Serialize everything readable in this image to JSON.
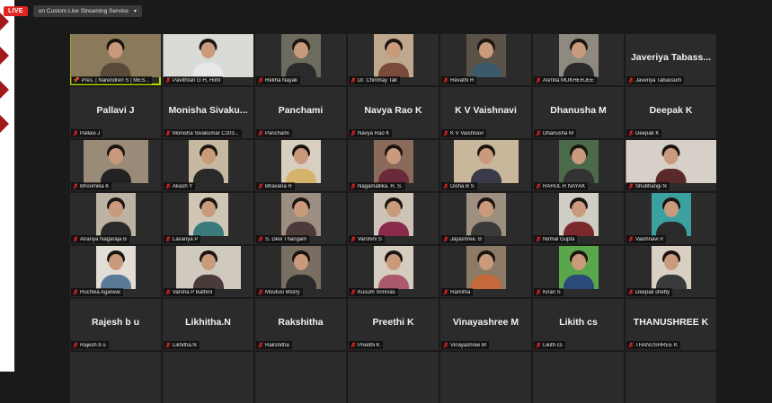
{
  "topbar": {
    "live_badge": "LIVE",
    "stream_dropdown": "on Custom Live Streaming Service"
  },
  "participants": [
    {
      "label": "Pres. | Narendren S | MES...",
      "display": "video",
      "highlight": true,
      "pinned": true,
      "bg": "#8a7a5a",
      "shirt": "#5a4a3a"
    },
    {
      "label": "Pavithran G H, Himt",
      "display": "video",
      "bg": "#d9dcd6",
      "shirt": "#e8e8e8"
    },
    {
      "label": "Rekha Nayak",
      "display": "video",
      "bg": "#6d6a5e",
      "shirt": "#2a2a2a"
    },
    {
      "label": "Dr. Chinmay Tak",
      "display": "video",
      "bg": "#bfa88e",
      "shirt": "#7a4a3a"
    },
    {
      "label": "Revathi R",
      "display": "video",
      "bg": "#5c5348",
      "shirt": "#3a5a6a"
    },
    {
      "label": "Asmita MUKHERJEE",
      "display": "video",
      "bg": "#8e8a80",
      "shirt": "#2a2a2a"
    },
    {
      "label": "Javeriya Tabassum",
      "display": "name",
      "name": "Javeriya Tabass..."
    },
    {
      "label": "Pallavi J",
      "display": "name",
      "name": "Pallavi J"
    },
    {
      "label": "Monisha Sivakumar C203...",
      "display": "name",
      "name": "Monisha Sivaku..."
    },
    {
      "label": "Panchami",
      "display": "name",
      "name": "Panchami"
    },
    {
      "label": "Navya Rao K",
      "display": "name",
      "name": "Navya Rao K"
    },
    {
      "label": "K V Vaishnavi",
      "display": "name",
      "name": "K V Vaishnavi"
    },
    {
      "label": "Dhanusha M",
      "display": "name",
      "name": "Dhanusha M"
    },
    {
      "label": "Deepak K",
      "display": "name",
      "name": "Deepak K"
    },
    {
      "label": "Bhoomika K",
      "display": "video",
      "bg": "#9a8a78",
      "shirt": "#222"
    },
    {
      "label": "Akash Y",
      "display": "video",
      "bg": "#c7b9a1",
      "shirt": "#2a2a2a"
    },
    {
      "label": "Bhavana R",
      "display": "video",
      "bg": "#d8cfc1",
      "shirt": "#d6b36a"
    },
    {
      "label": "Nagamallika. R. S.",
      "display": "video",
      "bg": "#8a6a5a",
      "shirt": "#6a2a3a"
    },
    {
      "label": "Disha B S",
      "display": "video",
      "bg": "#c8b79a",
      "shirt": "#3a3a4a"
    },
    {
      "label": "RAHUL R NAYAK",
      "display": "video",
      "bg": "#4a6a4a",
      "shirt": "#333"
    },
    {
      "label": "Shubhangi N",
      "display": "video",
      "bg": "#d6d0c8",
      "shirt": "#5a2a2a"
    },
    {
      "label": "Ananya Nagaraja B",
      "display": "video",
      "bg": "#bdb3a4",
      "shirt": "#2a2a2a"
    },
    {
      "label": "Lavanya P",
      "display": "video",
      "bg": "#cfc6b5",
      "shirt": "#3a7a7a"
    },
    {
      "label": "S. Devi Thangam",
      "display": "video",
      "bg": "#9c8e80",
      "shirt": "#4a3a3a"
    },
    {
      "label": "Varshini S",
      "display": "video",
      "bg": "#cdc4b7",
      "shirt": "#8a2a4a"
    },
    {
      "label": "Jayashree. B",
      "display": "video",
      "bg": "#9e9080",
      "shirt": "#3a3a3a"
    },
    {
      "label": "Nirmal Gupta",
      "display": "video",
      "bg": "#d0cdc6",
      "shirt": "#7a2a2a"
    },
    {
      "label": "Vaishnavi.V",
      "display": "video",
      "bg": "#3aa0a0",
      "shirt": "#2a2a2a"
    },
    {
      "label": "Ruchika Agarwal",
      "display": "video",
      "bg": "#e2ddd5",
      "shirt": "#5a7a9a"
    },
    {
      "label": "Varsha P Bathini",
      "display": "video",
      "bg": "#cfc9be",
      "shirt": "#4a3a3a"
    },
    {
      "label": "Moutusi Mistry",
      "display": "video",
      "bg": "#7a6e62",
      "shirt": "#2a2a2a"
    },
    {
      "label": "Kusum Srinivas",
      "display": "video",
      "bg": "#d5cdc0",
      "shirt": "#aa5a6a"
    },
    {
      "label": "Ramitha",
      "display": "video",
      "bg": "#8a7a66",
      "shirt": "#c46a3a"
    },
    {
      "label": "Kiran S",
      "display": "video",
      "bg": "#5aa64a",
      "shirt": "#2a4a7a"
    },
    {
      "label": "Deepali shetty",
      "display": "video",
      "bg": "#d8d0c2",
      "shirt": "#3a3a3a"
    },
    {
      "label": "Rajesh b u",
      "display": "name",
      "name": "Rajesh b u"
    },
    {
      "label": "Likhitha.N",
      "display": "name",
      "name": "Likhitha.N"
    },
    {
      "label": "Rakshitha",
      "display": "name",
      "name": "Rakshitha"
    },
    {
      "label": "Preethi K",
      "display": "name",
      "name": "Preethi K"
    },
    {
      "label": "Vinayashree M",
      "display": "name",
      "name": "Vinayashree M"
    },
    {
      "label": "Likith cs",
      "display": "name",
      "name": "Likith cs"
    },
    {
      "label": "THANUSHREE K",
      "display": "name",
      "name": "THANUSHREE K"
    }
  ],
  "colors": {
    "highlight_border": "#b8d100",
    "muted_mic": "#e02424",
    "tile_bg": "#2b2b2b",
    "live_badge": "#e02424"
  },
  "icons": {
    "muted": "mic-muted-icon",
    "pinned": "pin-icon"
  }
}
